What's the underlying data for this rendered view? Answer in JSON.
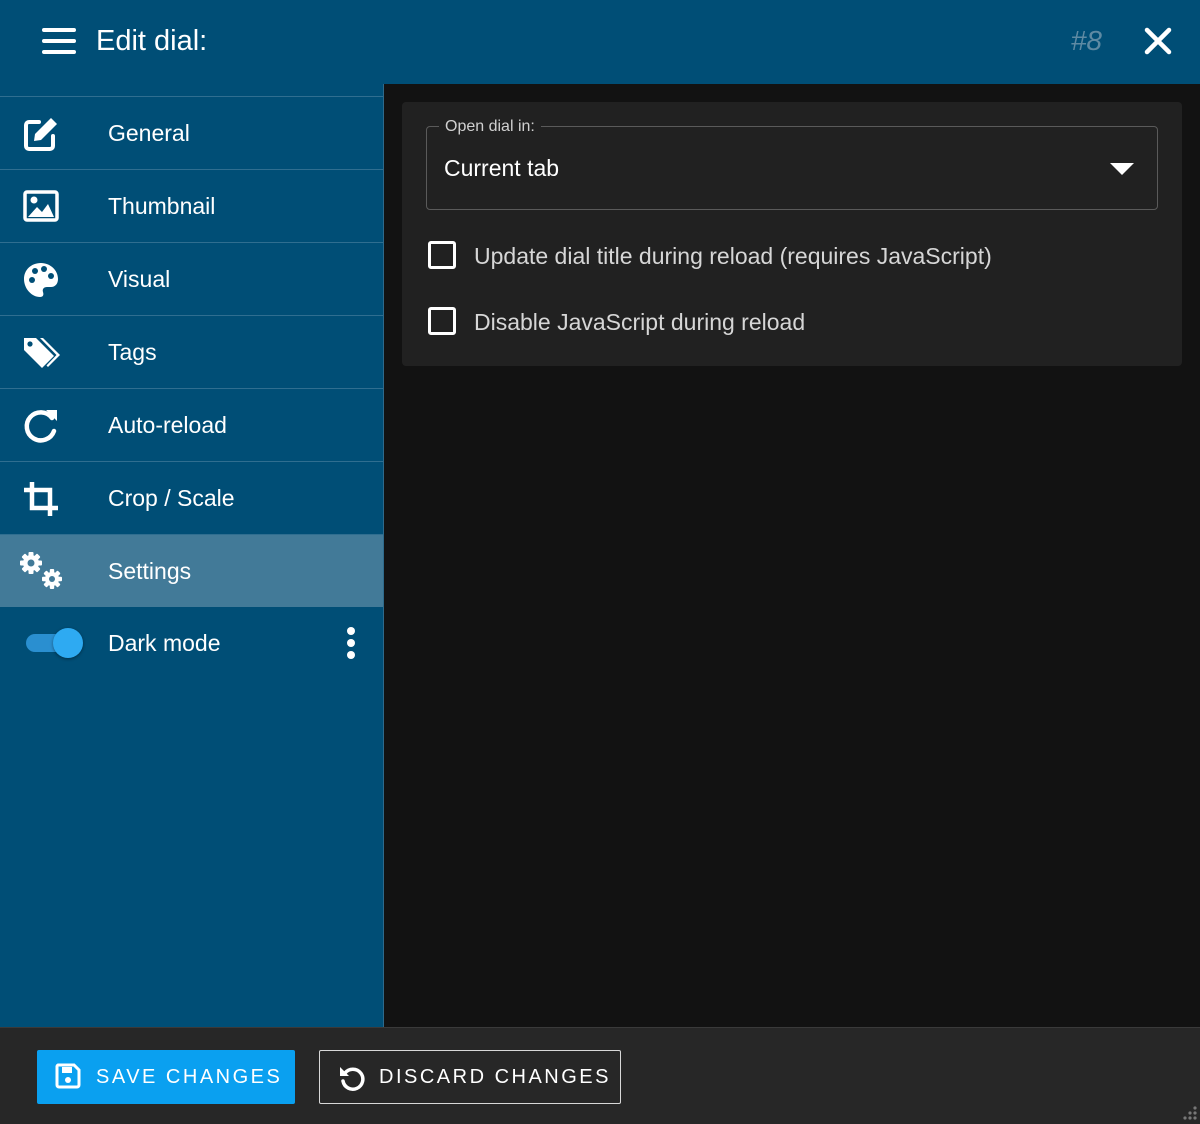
{
  "header": {
    "title": "Edit dial:",
    "dial_number": "#8"
  },
  "sidebar": {
    "items": [
      {
        "label": "General",
        "icon": "edit-icon"
      },
      {
        "label": "Thumbnail",
        "icon": "image-icon"
      },
      {
        "label": "Visual",
        "icon": "palette-icon"
      },
      {
        "label": "Tags",
        "icon": "tags-icon"
      },
      {
        "label": "Auto-reload",
        "icon": "reload-icon"
      },
      {
        "label": "Crop / Scale",
        "icon": "crop-icon"
      },
      {
        "label": "Settings",
        "icon": "gears-icon",
        "active": true
      }
    ],
    "dark_mode": {
      "label": "Dark mode",
      "enabled": true
    }
  },
  "settings": {
    "open_dial": {
      "legend": "Open dial in:",
      "value": "Current tab"
    },
    "checkboxes": [
      {
        "label": "Update dial title during reload (requires JavaScript)",
        "checked": false
      },
      {
        "label": "Disable JavaScript during reload",
        "checked": false
      }
    ]
  },
  "footer": {
    "save_label": "SAVE CHANGES",
    "discard_label": "DISCARD CHANGES"
  },
  "colors": {
    "header_bg": "#004e76",
    "sidebar_active": "#427a98",
    "accent": "#0aa0f0",
    "content_bg": "#121212",
    "card_bg": "#212121"
  }
}
